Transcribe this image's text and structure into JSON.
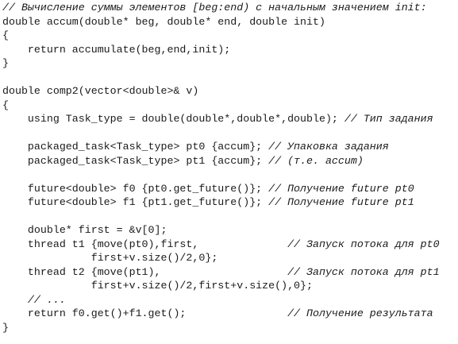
{
  "lines": [
    {
      "code": "",
      "comment": "// Вычисление суммы элементов [beg:end) с начальным значением init:"
    },
    {
      "code": "double accum(double* beg, double* end, double init)",
      "comment": ""
    },
    {
      "code": "{",
      "comment": ""
    },
    {
      "code": "    return accumulate(beg,end,init);",
      "comment": ""
    },
    {
      "code": "}",
      "comment": ""
    },
    {
      "code": "",
      "comment": ""
    },
    {
      "code": "double comp2(vector<double>& v)",
      "comment": ""
    },
    {
      "code": "{",
      "comment": ""
    },
    {
      "code": "    using Task_type = double(double*,double*,double); ",
      "comment": "// Тип задания"
    },
    {
      "code": "",
      "comment": ""
    },
    {
      "code": "    packaged_task<Task_type> pt0 {accum}; ",
      "comment": "// Упаковка задания"
    },
    {
      "code": "    packaged_task<Task_type> pt1 {accum}; ",
      "comment": "// (т.е. accum)"
    },
    {
      "code": "",
      "comment": ""
    },
    {
      "code": "    future<double> f0 {pt0.get_future()}; ",
      "comment": "// Получение future pt0"
    },
    {
      "code": "    future<double> f1 {pt1.get_future()}; ",
      "comment": "// Получение future pt1"
    },
    {
      "code": "",
      "comment": ""
    },
    {
      "code": "    double* first = &v[0];",
      "comment": ""
    },
    {
      "code": "    thread t1 {move(pt0),first,              ",
      "comment": "// Запуск потока для pt0"
    },
    {
      "code": "              first+v.size()/2,0};",
      "comment": ""
    },
    {
      "code": "    thread t2 {move(pt1),                    ",
      "comment": "// Запуск потока для pt1"
    },
    {
      "code": "              first+v.size()/2,first+v.size(),0};",
      "comment": ""
    },
    {
      "code": "    ",
      "comment": "// ..."
    },
    {
      "code": "    return f0.get()+f1.get();                ",
      "comment": "// Получение результата"
    },
    {
      "code": "}",
      "comment": ""
    }
  ]
}
